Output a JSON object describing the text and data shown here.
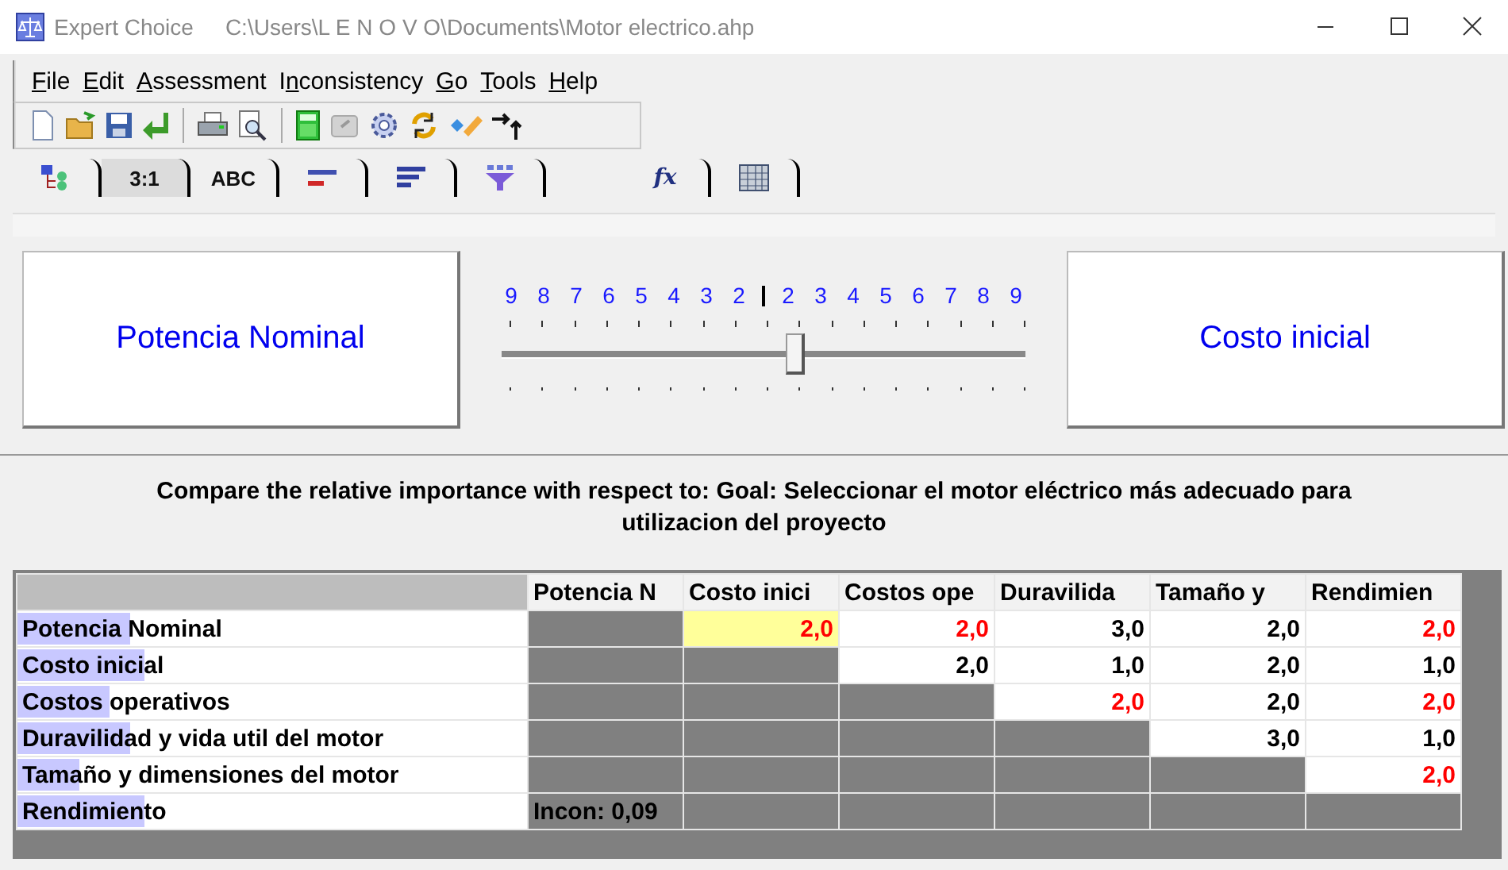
{
  "window": {
    "app": "Expert Choice",
    "path": "C:\\Users\\L E N O V O\\Documents\\Motor electrico.ahp"
  },
  "menu": [
    {
      "key": "F",
      "rest": "ile"
    },
    {
      "key": "E",
      "rest": "dit"
    },
    {
      "key": "A",
      "rest": "ssessment"
    },
    {
      "pre": "I",
      "key": "n",
      "rest": "consistency"
    },
    {
      "key": "G",
      "rest": "o"
    },
    {
      "key": "T",
      "rest": "ools"
    },
    {
      "key": "H",
      "rest": "elp"
    }
  ],
  "tabs": [
    {
      "selected": false
    },
    {
      "label": "3:1",
      "selected": true
    },
    {
      "label": "ABC",
      "selected": false
    },
    {
      "selected": false
    },
    {
      "selected": false
    },
    {
      "selected": false
    },
    {
      "label": "fx",
      "selected": false
    },
    {
      "selected": false
    }
  ],
  "comparison": {
    "left": "Potencia Nominal",
    "right": "Costo inicial",
    "scale": [
      "9",
      "8",
      "7",
      "6",
      "5",
      "4",
      "3",
      "2",
      "2",
      "3",
      "4",
      "5",
      "6",
      "7",
      "8",
      "9"
    ],
    "level": 0.56
  },
  "prompt": "Compare the relative importance with respect to: Goal: Seleccionar el motor eléctrico más adecuado para utilizacion del proyecto",
  "table": {
    "columns": [
      "Potencia N",
      "Costo inici",
      "Costos ope",
      "Duravilida",
      "Tamaño y",
      "Rendimien"
    ],
    "rows": [
      {
        "label": "Potencia Nominal",
        "level": 0.22,
        "cells": [
          {
            "kind": "blank"
          },
          {
            "kind": "value",
            "value": "2,0",
            "inverse": true,
            "selected": true
          },
          {
            "kind": "value",
            "value": "2,0",
            "inverse": true,
            "selected": false
          },
          {
            "kind": "value",
            "value": "3,0",
            "inverse": false,
            "selected": false
          },
          {
            "kind": "value",
            "value": "2,0",
            "inverse": false,
            "selected": false
          },
          {
            "kind": "value",
            "value": "2,0",
            "inverse": true,
            "selected": false
          }
        ]
      },
      {
        "label": "Costo inicial",
        "level": 0.25,
        "cells": [
          {
            "kind": "blank"
          },
          {
            "kind": "blank"
          },
          {
            "kind": "value",
            "value": "2,0",
            "inverse": false,
            "selected": false
          },
          {
            "kind": "value",
            "value": "1,0",
            "inverse": false,
            "selected": false
          },
          {
            "kind": "value",
            "value": "2,0",
            "inverse": false,
            "selected": false
          },
          {
            "kind": "value",
            "value": "1,0",
            "inverse": false,
            "selected": false
          }
        ]
      },
      {
        "label": "Costos operativos",
        "level": 0.18,
        "cells": [
          {
            "kind": "blank"
          },
          {
            "kind": "blank"
          },
          {
            "kind": "blank"
          },
          {
            "kind": "value",
            "value": "2,0",
            "inverse": true,
            "selected": false
          },
          {
            "kind": "value",
            "value": "2,0",
            "inverse": false,
            "selected": false
          },
          {
            "kind": "value",
            "value": "2,0",
            "inverse": true,
            "selected": false
          }
        ]
      },
      {
        "label": "Duravilidad y vida util del motor",
        "level": 0.22,
        "cells": [
          {
            "kind": "blank"
          },
          {
            "kind": "blank"
          },
          {
            "kind": "blank"
          },
          {
            "kind": "blank"
          },
          {
            "kind": "value",
            "value": "3,0",
            "inverse": false,
            "selected": false
          },
          {
            "kind": "value",
            "value": "1,0",
            "inverse": false,
            "selected": false
          }
        ]
      },
      {
        "label": "Tamaño y dimensiones del motor",
        "level": 0.12,
        "cells": [
          {
            "kind": "blank"
          },
          {
            "kind": "blank"
          },
          {
            "kind": "blank"
          },
          {
            "kind": "blank"
          },
          {
            "kind": "blank"
          },
          {
            "kind": "value",
            "value": "2,0",
            "inverse": true,
            "selected": false
          }
        ]
      },
      {
        "label": "Rendimiento",
        "level": 0.25,
        "cells": [
          {
            "kind": "note",
            "value": "Incon: 0,09"
          },
          {
            "kind": "blank"
          },
          {
            "kind": "blank"
          },
          {
            "kind": "blank"
          },
          {
            "kind": "blank"
          },
          {
            "kind": "blank"
          }
        ]
      }
    ]
  }
}
